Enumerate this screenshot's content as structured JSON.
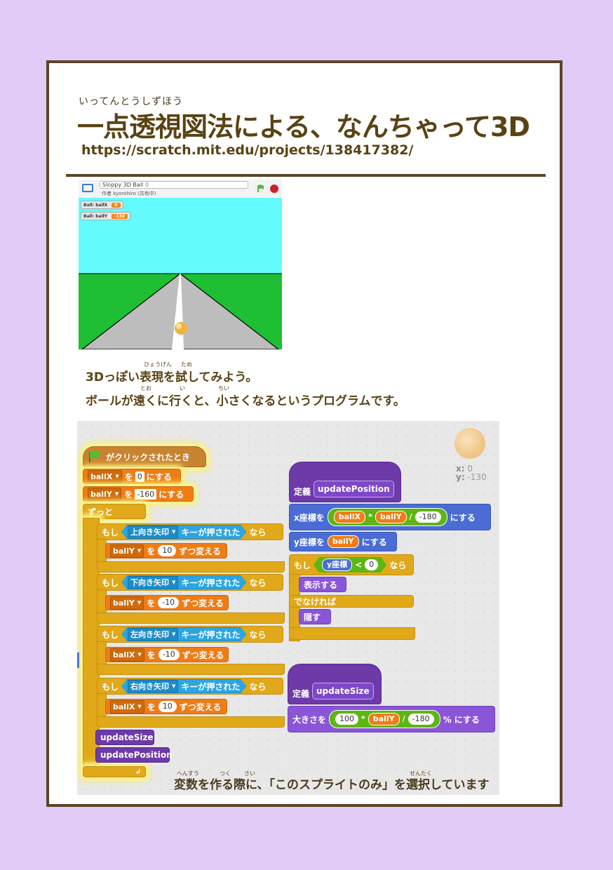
{
  "header": {
    "ruby": "いってんとうしずほう",
    "title": "一点透視図法による、なんちゃって3D",
    "url": "https://scratch.mit.edu/projects/138417382/"
  },
  "stage": {
    "project_title": "Sloppy 3D Ball",
    "author": "作者 kyorohiro (共有中)",
    "monitors": [
      {
        "label": "Ball: ballX",
        "value": "0"
      },
      {
        "label": "Ball: ballY",
        "value": "-130"
      }
    ]
  },
  "description": {
    "line1": "3Dっぽい表現を試してみよう。",
    "line2": "ボールが遠くに行くと、小さくなるというプログラムです。",
    "ruby_hyougen": "ひょうげん",
    "ruby_tame": "ため",
    "ruby_too": "とお",
    "ruby_i": "い",
    "ruby_chii": "ちい"
  },
  "sprite": {
    "x_label": "x:",
    "x": "0",
    "y_label": "y:",
    "y": "-130"
  },
  "script": {
    "hat": "がクリックされたとき",
    "set_ballX": {
      "var": "ballX",
      "to": "を",
      "value": "0",
      "tail": "にする"
    },
    "set_ballY": {
      "var": "ballY",
      "to": "を",
      "value": "-160",
      "tail": "にする"
    },
    "forever": "ずっと",
    "if_label": "もし",
    "then_label": "なら",
    "key_pressed": "キーが押された",
    "change_tail": "ずつ変える",
    "to": "を",
    "ifs": [
      {
        "key": "上向き矢印",
        "var": "ballY",
        "value": "10"
      },
      {
        "key": "下向き矢印",
        "var": "ballY",
        "value": "-10"
      },
      {
        "key": "左向き矢印",
        "var": "ballX",
        "value": "-10"
      },
      {
        "key": "右向き矢印",
        "var": "ballX",
        "value": "10"
      }
    ],
    "call_size": "updateSize",
    "call_position": "updatePosition"
  },
  "def_position": {
    "define": "定義",
    "name": "updatePosition",
    "setx": "x座標を",
    "ballX": "ballX",
    "mul": "*",
    "ballY": "ballY",
    "div": "/",
    "n180": "-180",
    "set_tail": "にする",
    "sety": "y座標を",
    "if": "もし",
    "ypos": "y座標",
    "lt": "<",
    "zero": "0",
    "then": "なら",
    "show": "表示する",
    "else": "でなければ",
    "hide": "隠す"
  },
  "def_size": {
    "define": "定義",
    "name": "updateSize",
    "setsize": "大きさを",
    "n100": "100",
    "mul": "*",
    "ballY": "ballY",
    "div": "/",
    "n180": "-180",
    "tail": "% にする"
  },
  "caption": {
    "text": "変数を作る際に、「このスプライトのみ」を選択しています",
    "ruby_hensuu": "へんすう",
    "ruby_tsuku": "つく",
    "ruby_sai": "さい",
    "ruby_sentaku": "せんたく"
  },
  "colors": {
    "border": "#5b4526",
    "band": "#e0ccf7",
    "title": "#5a4213",
    "sky": "#64fbfd",
    "grass": "#1ebf35"
  }
}
